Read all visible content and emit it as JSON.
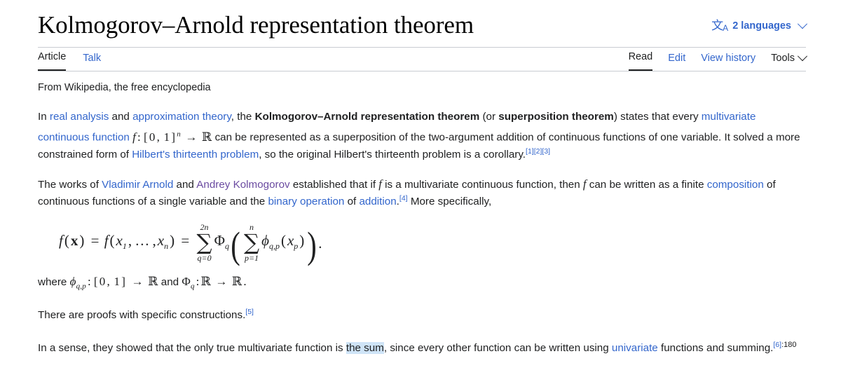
{
  "header": {
    "title": "Kolmogorov–Arnold representation theorem",
    "language_selector": {
      "icon": "language-icon",
      "icon_glyph_cjk": "文",
      "icon_glyph_latin": "A",
      "label": "2 languages",
      "chevron": "chevron-down-icon"
    }
  },
  "namespace_tabs": [
    {
      "label": "Article",
      "active": true
    },
    {
      "label": "Talk",
      "active": false
    }
  ],
  "view_tabs": [
    {
      "label": "Read",
      "active": true
    },
    {
      "label": "Edit",
      "active": false
    },
    {
      "label": "View history",
      "active": false
    }
  ],
  "tools_menu": {
    "label": "Tools",
    "chevron": "chevron-down-icon"
  },
  "content": {
    "site_sub": "From Wikipedia, the free encyclopedia",
    "paragraph1": {
      "t1": "In ",
      "link_real_analysis": "real analysis",
      "t2": " and ",
      "link_approximation_theory": "approximation theory",
      "t3": ", the ",
      "bold_theorem": "Kolmogorov–Arnold representation theorem",
      "t4": " (or ",
      "bold_superposition": "superposition theorem",
      "t5": ") states that every ",
      "link_multivariate": "multivariate",
      "t6": " ",
      "link_continuous_function": "continuous function",
      "math_domain": "f: [0, 1]ⁿ → ℝ",
      "t7": " can be represented as a superposition of the two-argument addition of continuous functions of one variable. It solved a more constrained form of ",
      "link_hilbert13": "Hilbert's thirteenth problem",
      "t8": ", so the original Hilbert's thirteenth problem is a corollary.",
      "refs": [
        "[1]",
        "[2]",
        "[3]"
      ]
    },
    "paragraph2": {
      "t1": "The works of ",
      "link_vladimir_arnold": "Vladimir Arnold",
      "t2": " and ",
      "link_andrey_kolmogorov": "Andrey Kolmogorov",
      "t3": " established that if ",
      "var_f_1": "f",
      "t4": " is a multivariate continuous function, then ",
      "var_f_2": "f",
      "t5": " can be written as a finite ",
      "link_composition": "composition",
      "t6": " of continuous functions of a single variable and the ",
      "link_binary_operation": "binary operation",
      "t7": " of ",
      "link_addition": "addition",
      "t8": ".",
      "ref": "[4]",
      "t9": " More specifically,"
    },
    "display_equation": {
      "lhs": "f(x) = f(x₁, …, xₙ) =",
      "outer_sum_upper": "2n",
      "outer_sum_lower": "q=0",
      "outer_fn": "Φ",
      "outer_fn_sub": "q",
      "inner_sum_upper": "n",
      "inner_sum_lower": "p=1",
      "inner_fn": "φ",
      "inner_fn_sub": "q,p",
      "inner_arg": "(x_p)",
      "trailing": "."
    },
    "where_line": {
      "prefix": "where ",
      "phi": "φ",
      "phi_sub": "q,p",
      "phi_map": ": [0, 1] → ℝ",
      "conj": " and ",
      "Phi": "Φ",
      "Phi_sub": "q",
      "Phi_map": ": ℝ → ℝ",
      "period": "."
    },
    "paragraph3": {
      "text": "There are proofs with specific constructions.",
      "ref": "[5]"
    },
    "paragraph4": {
      "t1": "In a sense, they showed that the only true multivariate function is ",
      "selected_text": "the sum",
      "t2": ", since every other function can be written using ",
      "link_univariate": "univariate",
      "t3": " functions and summing.",
      "ref": "[6]",
      "page_number": ":180"
    }
  },
  "colors": {
    "link": "#3366cc",
    "link_visited": "#6b4ba1",
    "text": "#202122",
    "selection_highlight": "#cfe4f7",
    "rule": "#c8ccd1"
  }
}
